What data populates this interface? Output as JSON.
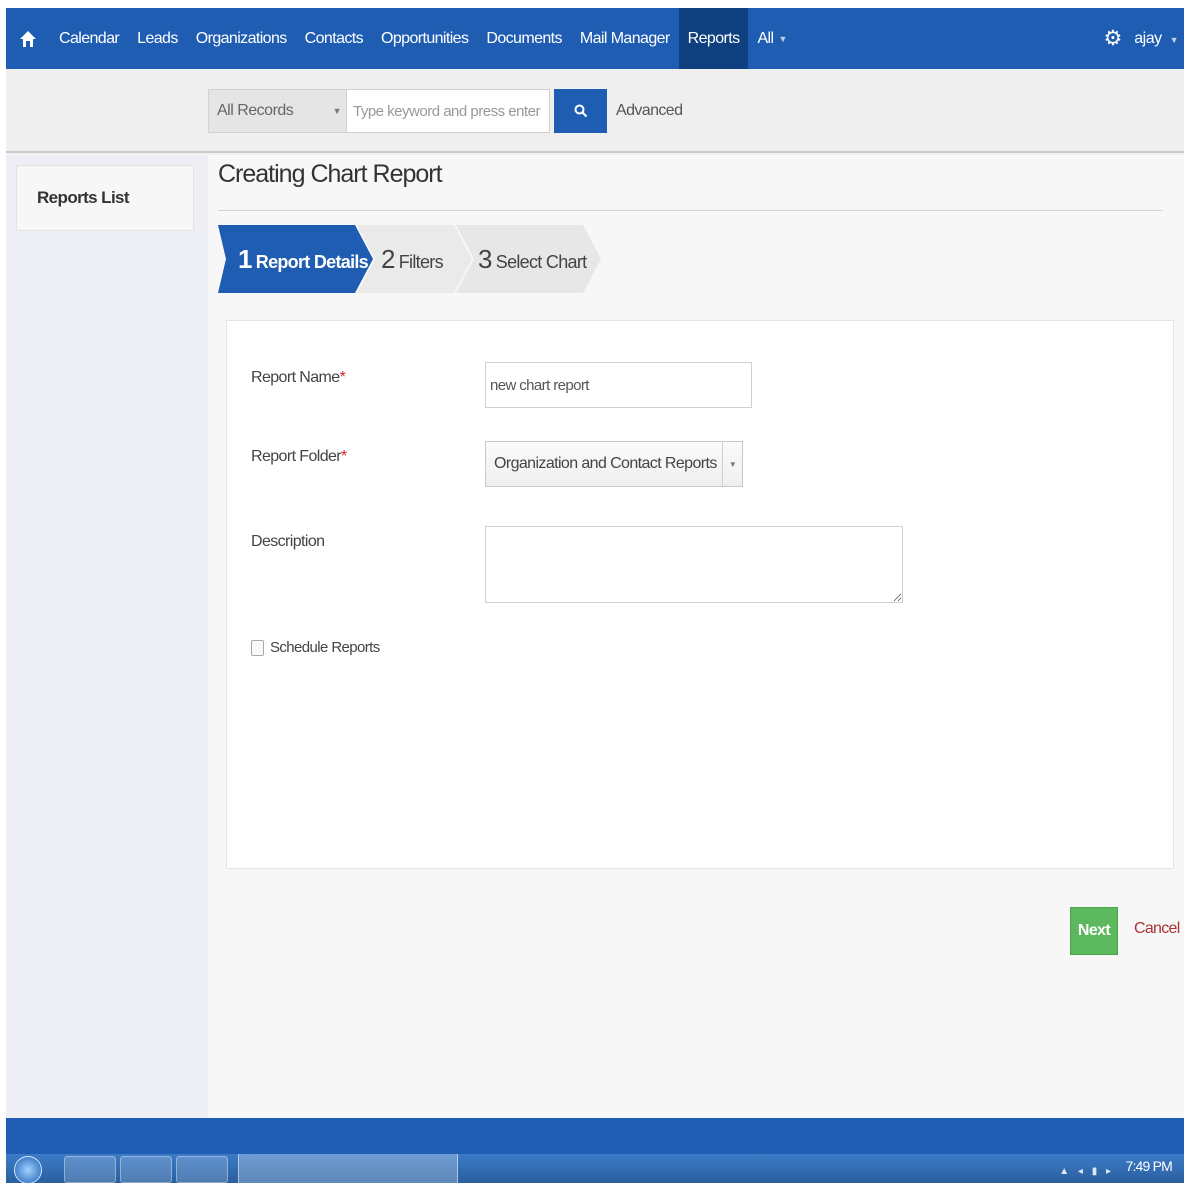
{
  "nav": {
    "items": [
      {
        "label": "Calendar"
      },
      {
        "label": "Leads"
      },
      {
        "label": "Organizations"
      },
      {
        "label": "Contacts"
      },
      {
        "label": "Opportunities"
      },
      {
        "label": "Documents"
      },
      {
        "label": "Mail Manager"
      },
      {
        "label": "Reports",
        "active": true
      }
    ],
    "all_label": "All",
    "user": "ajay"
  },
  "search": {
    "record_filter": "All Records",
    "placeholder": "Type keyword and press enter",
    "advanced_label": "Advanced"
  },
  "sidebar": {
    "reports_list_label": "Reports List"
  },
  "page": {
    "title": "Creating Chart Report",
    "steps": [
      {
        "number": "1",
        "label": "Report Details",
        "active": true
      },
      {
        "number": "2",
        "label": "Filters",
        "active": false
      },
      {
        "number": "3",
        "label": "Select Chart",
        "active": false
      }
    ]
  },
  "form": {
    "report_name_label": "Report Name",
    "report_name_value": "new chart report",
    "report_folder_label": "Report Folder",
    "report_folder_value": "Organization and Contact Reports",
    "description_label": "Description",
    "description_value": "",
    "schedule_label": "Schedule Reports",
    "schedule_checked": false,
    "required_marker": "*"
  },
  "actions": {
    "next_label": "Next",
    "cancel_label": "Cancel"
  },
  "taskbar": {
    "clock": "7:49 PM"
  },
  "colors": {
    "brand_blue": "#1f5db3",
    "active_nav": "#0e3f7f",
    "next_green": "#5cb85c",
    "cancel_red": "#a33333",
    "required_red": "#dd2222"
  }
}
